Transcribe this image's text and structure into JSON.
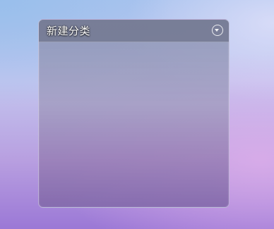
{
  "panel": {
    "title": "新建分类",
    "menu_icon": "chevron-down-circle-icon"
  }
}
